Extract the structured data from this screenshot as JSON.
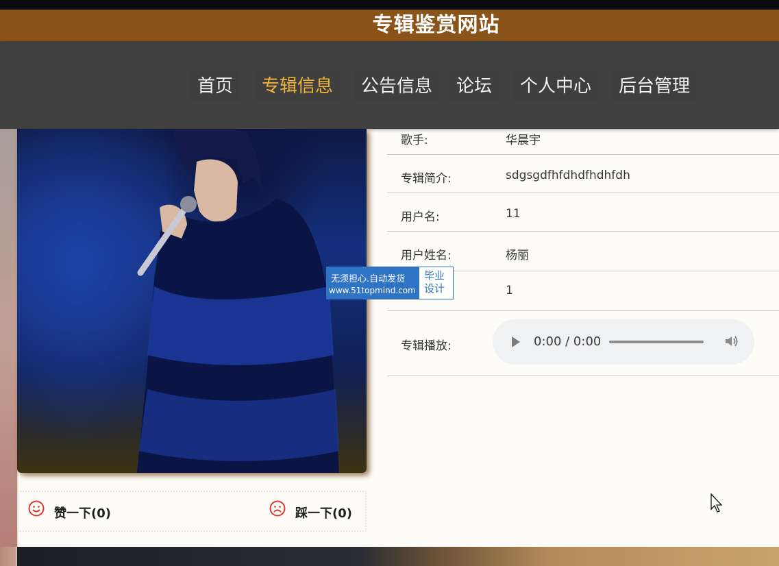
{
  "site": {
    "title": "专辑鉴赏网站"
  },
  "nav": {
    "items": [
      {
        "label": "首页"
      },
      {
        "label": "专辑信息"
      },
      {
        "label": "公告信息"
      },
      {
        "label": "论坛"
      },
      {
        "label": "个人中心"
      },
      {
        "label": "后台管理"
      }
    ],
    "active_color": "#f0b43c"
  },
  "album": {
    "fields": [
      {
        "label": "歌手:",
        "value": "华晨宇"
      },
      {
        "label": "专辑简介:",
        "value": "sdgsgdfhfdhdfhdhfdh"
      },
      {
        "label": "用户名:",
        "value": "11"
      },
      {
        "label": "用户姓名:",
        "value": "杨丽"
      },
      {
        "label": ":",
        "value": "1"
      }
    ],
    "player": {
      "label": "专辑播放:",
      "time": "0:00 / 0:00"
    }
  },
  "vote": {
    "like": "赞一下(0)",
    "dislike": "踩一下(0)"
  },
  "watermark": {
    "line1": "无须担心.自动发货",
    "line2": "www.51topmind.com",
    "side": "毕业设计"
  },
  "icons": {
    "play": "play-icon",
    "volume": "volume-icon",
    "like": "smile-icon",
    "dislike": "frown-icon",
    "cursor": "mouse-cursor-icon"
  },
  "colors": {
    "title_bar": "#8a5418",
    "nav_bg": "#414141",
    "vote_icon": "#e0362a",
    "watermark": "#2e73c4"
  }
}
